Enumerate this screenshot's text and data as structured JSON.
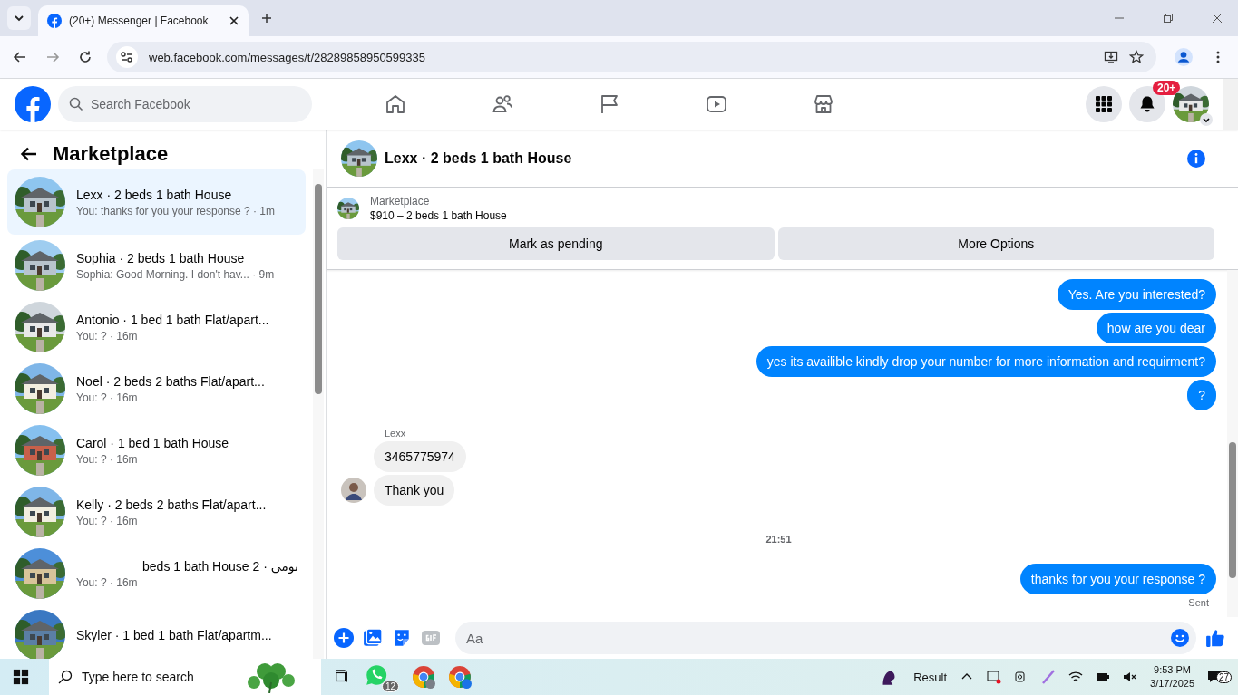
{
  "browser": {
    "tabs": [
      {
        "title": "(20+) Messenger | Facebook",
        "selected": true
      }
    ],
    "url": "web.facebook.com/messages/t/28289858950599335"
  },
  "header": {
    "search": {
      "placeholder": "Search Facebook"
    },
    "notification_badge": "20+"
  },
  "sidebar": {
    "title": "Marketplace",
    "conversations": [
      {
        "title": "Lexx · 2 beds 1 bath House",
        "preview": "You: thanks for you your response ? · 1m",
        "selected": true
      },
      {
        "title": "Sophia · 2 beds 1 bath House",
        "preview": "Sophia: Good Morning. I don't hav... · 9m",
        "selected": false
      },
      {
        "title": "Antonio · 1 bed 1 bath Flat/apart...",
        "preview": "You: ? · 16m",
        "selected": false
      },
      {
        "title": "Noel · 2 beds 2 baths Flat/apart...",
        "preview": "You: ? · 16m",
        "selected": false
      },
      {
        "title": "Carol · 1 bed 1 bath House",
        "preview": "You: ? · 16m",
        "selected": false
      },
      {
        "title": "Kelly · 2 beds 2 baths Flat/apart...",
        "preview": "You: ? · 16m",
        "selected": false
      },
      {
        "title": "تومی · 2 beds 1 bath House",
        "preview": "You: ? · 16m",
        "selected": false
      },
      {
        "title": "Skyler · 1 bed 1 bath Flat/apartm...",
        "selected": false
      }
    ]
  },
  "chat": {
    "title": "Lexx · 2 beds 1 bath House",
    "listing": {
      "label": "Marketplace",
      "item": "$910 – 2 beds 1 bath House"
    },
    "actions": [
      "Mark as pending",
      "More Options"
    ],
    "messages": [
      {
        "kind": "outgoing",
        "text": "Yes. Are you interested?"
      },
      {
        "kind": "outgoing",
        "text": "how are you dear"
      },
      {
        "kind": "outgoing",
        "text": "yes its availible kindly drop your number for more information and requirment?"
      },
      {
        "kind": "outgoing",
        "text": "?"
      },
      {
        "kind": "sender",
        "text": "Lexx"
      },
      {
        "kind": "incoming",
        "text": "3465775974"
      },
      {
        "kind": "incoming",
        "text": "Thank you",
        "avatar": true
      },
      {
        "kind": "time",
        "text": "21:51"
      },
      {
        "kind": "outgoing",
        "text": "thanks for you your response ?"
      },
      {
        "kind": "status",
        "text": "Sent"
      }
    ],
    "composer": {
      "placeholder": "Aa"
    }
  },
  "taskbar": {
    "search": {
      "placeholder": "Type here to search"
    },
    "whatsapp_badge": "12",
    "weather": "Result",
    "time": "9:53 PM",
    "date": "3/17/2025",
    "notifications": "27"
  }
}
